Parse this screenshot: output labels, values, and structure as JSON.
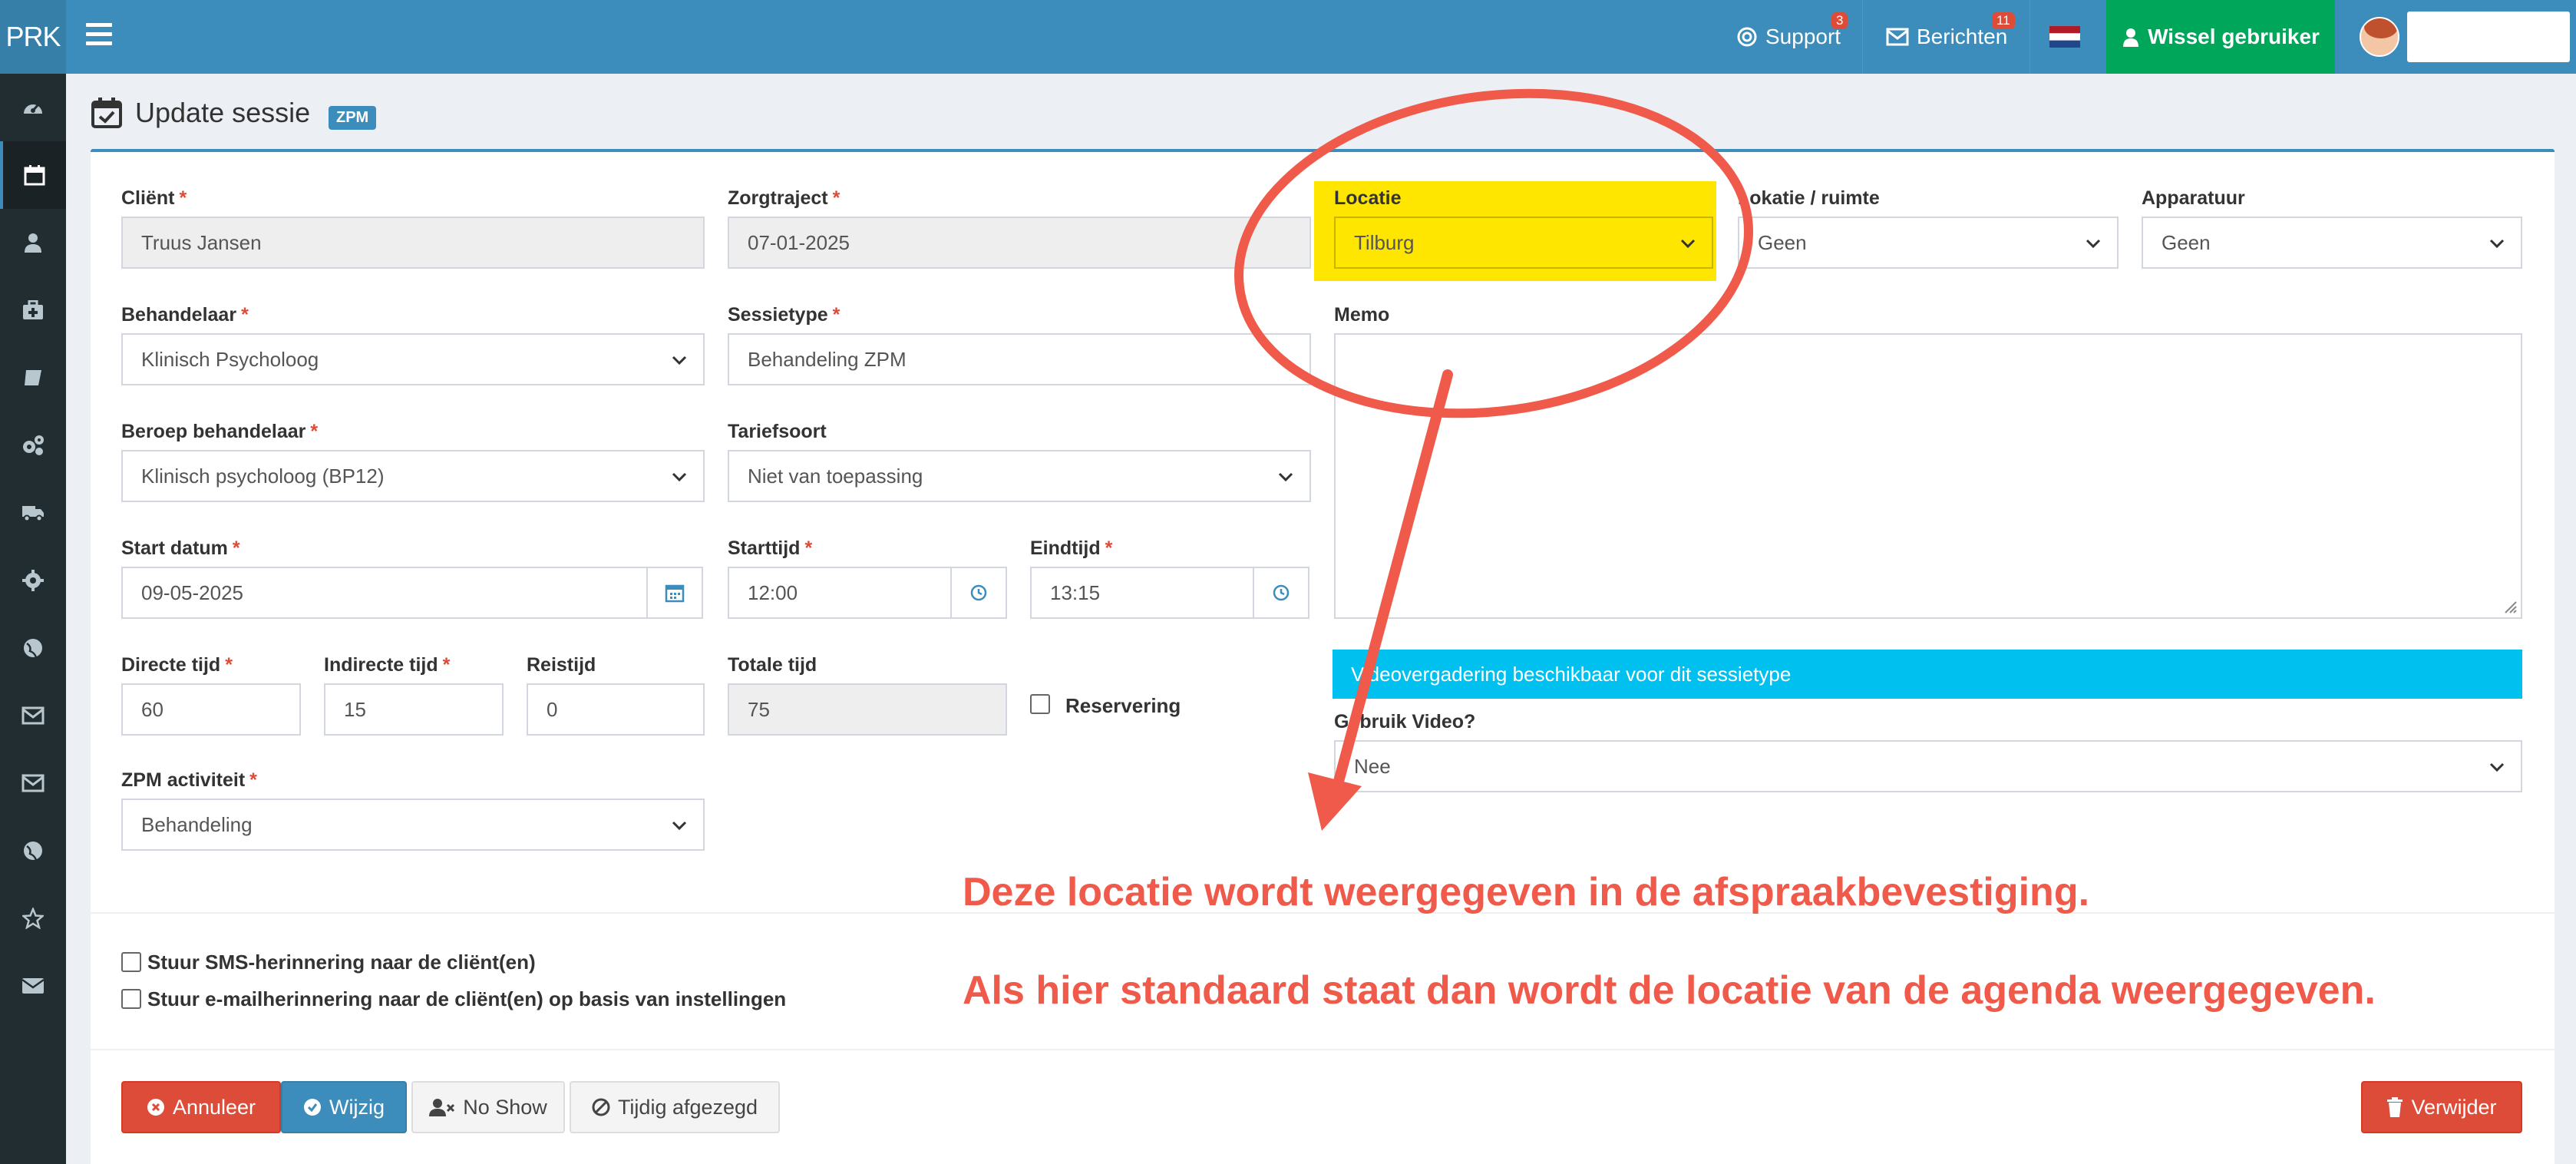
{
  "topbar": {
    "brand": "PRK",
    "support_label": "Support",
    "support_badge": "3",
    "berichten_label": "Berichten",
    "berichten_badge": "11",
    "wissel_label": "Wissel gebruiker"
  },
  "page": {
    "title": "Update sessie",
    "tag": "ZPM"
  },
  "form": {
    "client": {
      "label": "Cliënt",
      "required": "*",
      "value": "Truus Jansen"
    },
    "zorgtraject": {
      "label": "Zorgtraject",
      "required": "*",
      "value": "07-01-2025"
    },
    "locatie": {
      "label": "Locatie",
      "value": "Tilburg"
    },
    "lokatie_ruimte": {
      "label": "Lokatie / ruimte",
      "value": "Geen"
    },
    "apparatuur": {
      "label": "Apparatuur",
      "value": "Geen"
    },
    "behandelaar": {
      "label": "Behandelaar",
      "required": "*",
      "value": "Klinisch Psycholoog"
    },
    "sessietype": {
      "label": "Sessietype",
      "required": "*",
      "value": "Behandeling ZPM"
    },
    "memo": {
      "label": "Memo"
    },
    "beroep": {
      "label": "Beroep behandelaar",
      "required": "*",
      "value": "Klinisch psycholoog (BP12)"
    },
    "tariefsoort": {
      "label": "Tariefsoort",
      "value": "Niet van toepassing"
    },
    "start_datum": {
      "label": "Start datum",
      "required": "*",
      "value": "09-05-2025"
    },
    "starttijd": {
      "label": "Starttijd",
      "required": "*",
      "value": "12:00"
    },
    "eindtijd": {
      "label": "Eindtijd",
      "required": "*",
      "value": "13:15"
    },
    "directe_tijd": {
      "label": "Directe tijd",
      "required": "*",
      "value": "60"
    },
    "indirecte_tijd": {
      "label": "Indirecte tijd",
      "required": "*",
      "value": "15"
    },
    "reistijd": {
      "label": "Reistijd",
      "value": "0"
    },
    "totale_tijd": {
      "label": "Totale tijd",
      "value": "75"
    },
    "reservering": {
      "label": "Reservering"
    },
    "video_notice": "Videovergadering beschikbaar voor dit sessietype",
    "gebruik_video": {
      "label": "Gebruik Video?",
      "value": "Nee"
    },
    "zpm_activiteit": {
      "label": "ZPM activiteit",
      "required": "*",
      "value": "Behandeling"
    },
    "sms_reminder": "Stuur SMS-herinnering naar de cliënt(en)",
    "email_reminder": "Stuur e-mailherinnering naar de cliënt(en) op basis van instellingen"
  },
  "buttons": {
    "annuleer": "Annuleer",
    "wijzig": "Wijzig",
    "no_show": "No Show",
    "tijdig": "Tijdig afgezegd",
    "verwijder": "Verwijder"
  },
  "annotation": {
    "line1": "Deze locatie wordt weergegeven in de afspraakbevestiging.",
    "line2": "Als hier standaard staat dan wordt de locatie van de agenda weergegeven.",
    "color": "#f05a4a"
  },
  "colors": {
    "primary": "#3c8dbc",
    "success": "#00a65a",
    "danger": "#dd4b39",
    "info": "#00c0ef",
    "highlight": "#ffe600"
  }
}
